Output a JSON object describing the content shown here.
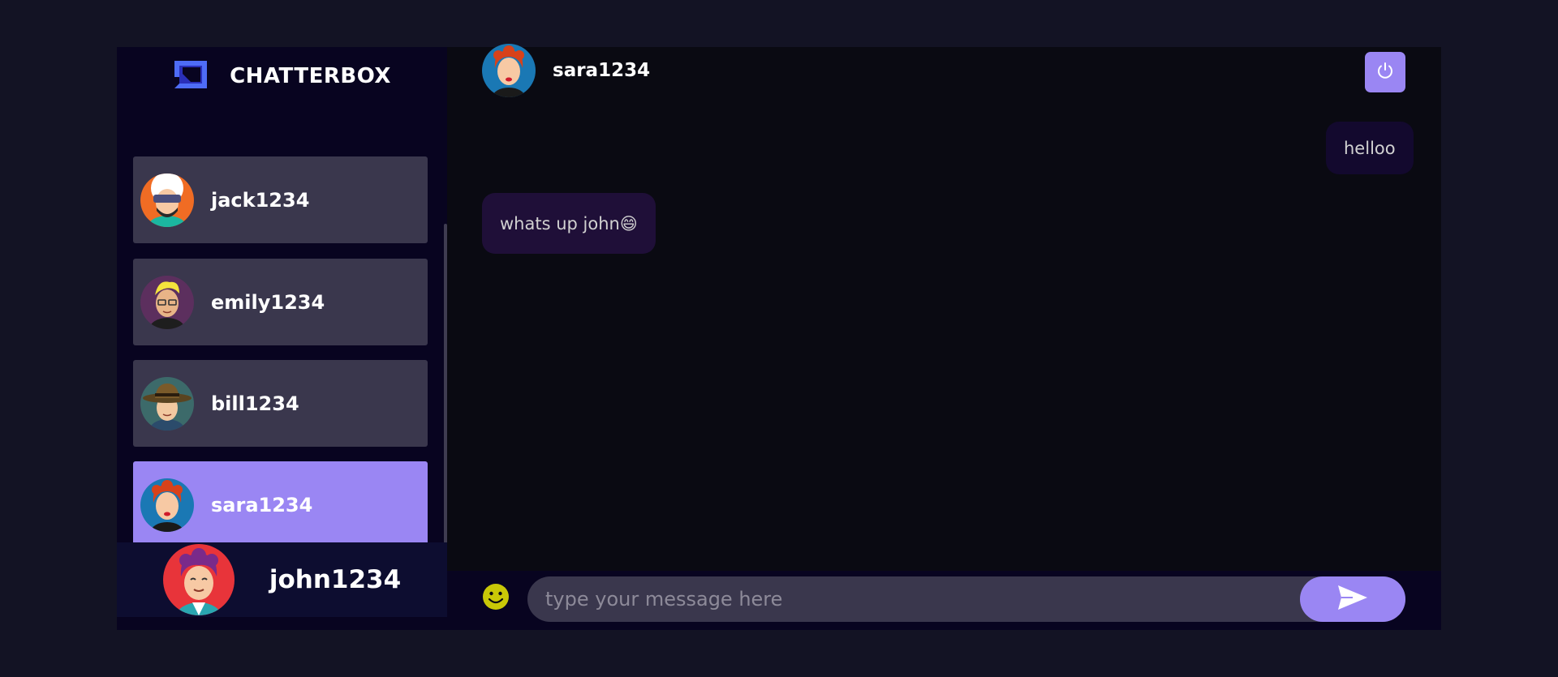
{
  "app": {
    "title": "CHATTERBOX"
  },
  "colors": {
    "accent": "#9a86f3",
    "background": "#131324",
    "sidebar": "#080420"
  },
  "contacts": [
    {
      "name": "jack1234",
      "avatar": "avatar-jack-icon",
      "selected": false
    },
    {
      "name": "emily1234",
      "avatar": "avatar-emily-icon",
      "selected": false
    },
    {
      "name": "bill1234",
      "avatar": "avatar-bill-icon",
      "selected": false
    },
    {
      "name": "sara1234",
      "avatar": "avatar-sara-icon",
      "selected": true
    },
    {
      "name": "",
      "avatar": "avatar-partial-icon",
      "selected": false
    }
  ],
  "current_user": {
    "name": "john1234",
    "avatar": "avatar-john-icon"
  },
  "chat": {
    "recipient": "sara1234",
    "messages": [
      {
        "direction": "sent",
        "text": "helloo"
      },
      {
        "direction": "received",
        "text": "whats up john😄"
      }
    ]
  },
  "composer": {
    "placeholder": "type your message here",
    "emoji_icon": "smiley-icon",
    "send_icon": "send-icon"
  },
  "header": {
    "logout_icon": "power-icon"
  }
}
